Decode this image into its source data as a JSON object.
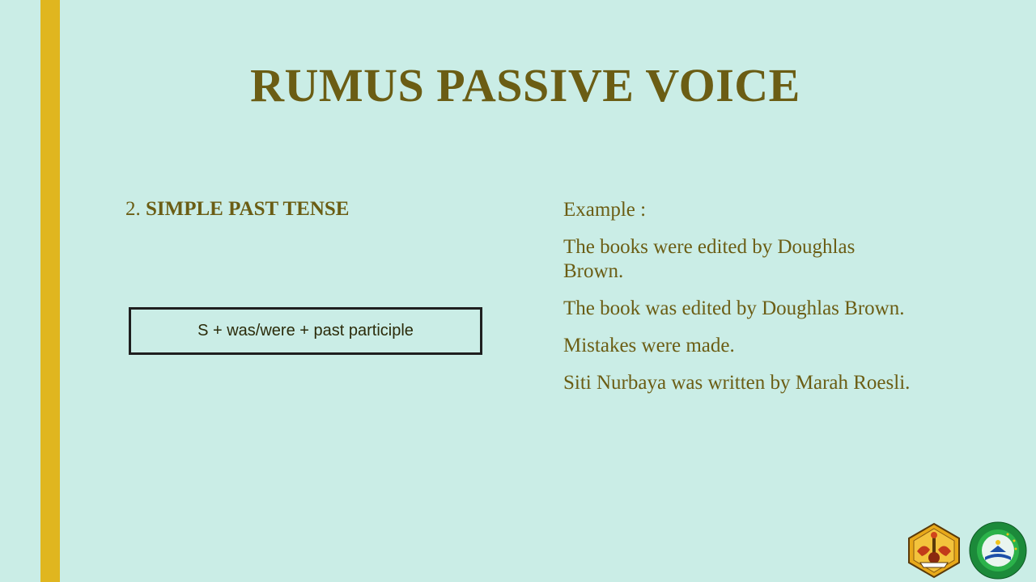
{
  "slide": {
    "title": "RUMUS PASSIVE VOICE",
    "section_number": "2.",
    "section_title": "SIMPLE PAST TENSE",
    "formula": "S + was/were + past participle",
    "examples_label": "Example :",
    "examples": [
      "The books were edited by Doughlas Brown.",
      "The book was edited by Doughlas Brown.",
      "Mistakes were made.",
      "Siti Nurbaya was written by Marah Roesli."
    ]
  },
  "logos": {
    "university": "university-crest-icon",
    "school": {
      "icon": "school-emblem-icon",
      "text": "SMK BAABUL KAMIL"
    }
  },
  "colors": {
    "background": "#caede6",
    "accent_bar": "#e0b61f",
    "text": "#6b5d14",
    "box_border": "#1f1f1f"
  }
}
